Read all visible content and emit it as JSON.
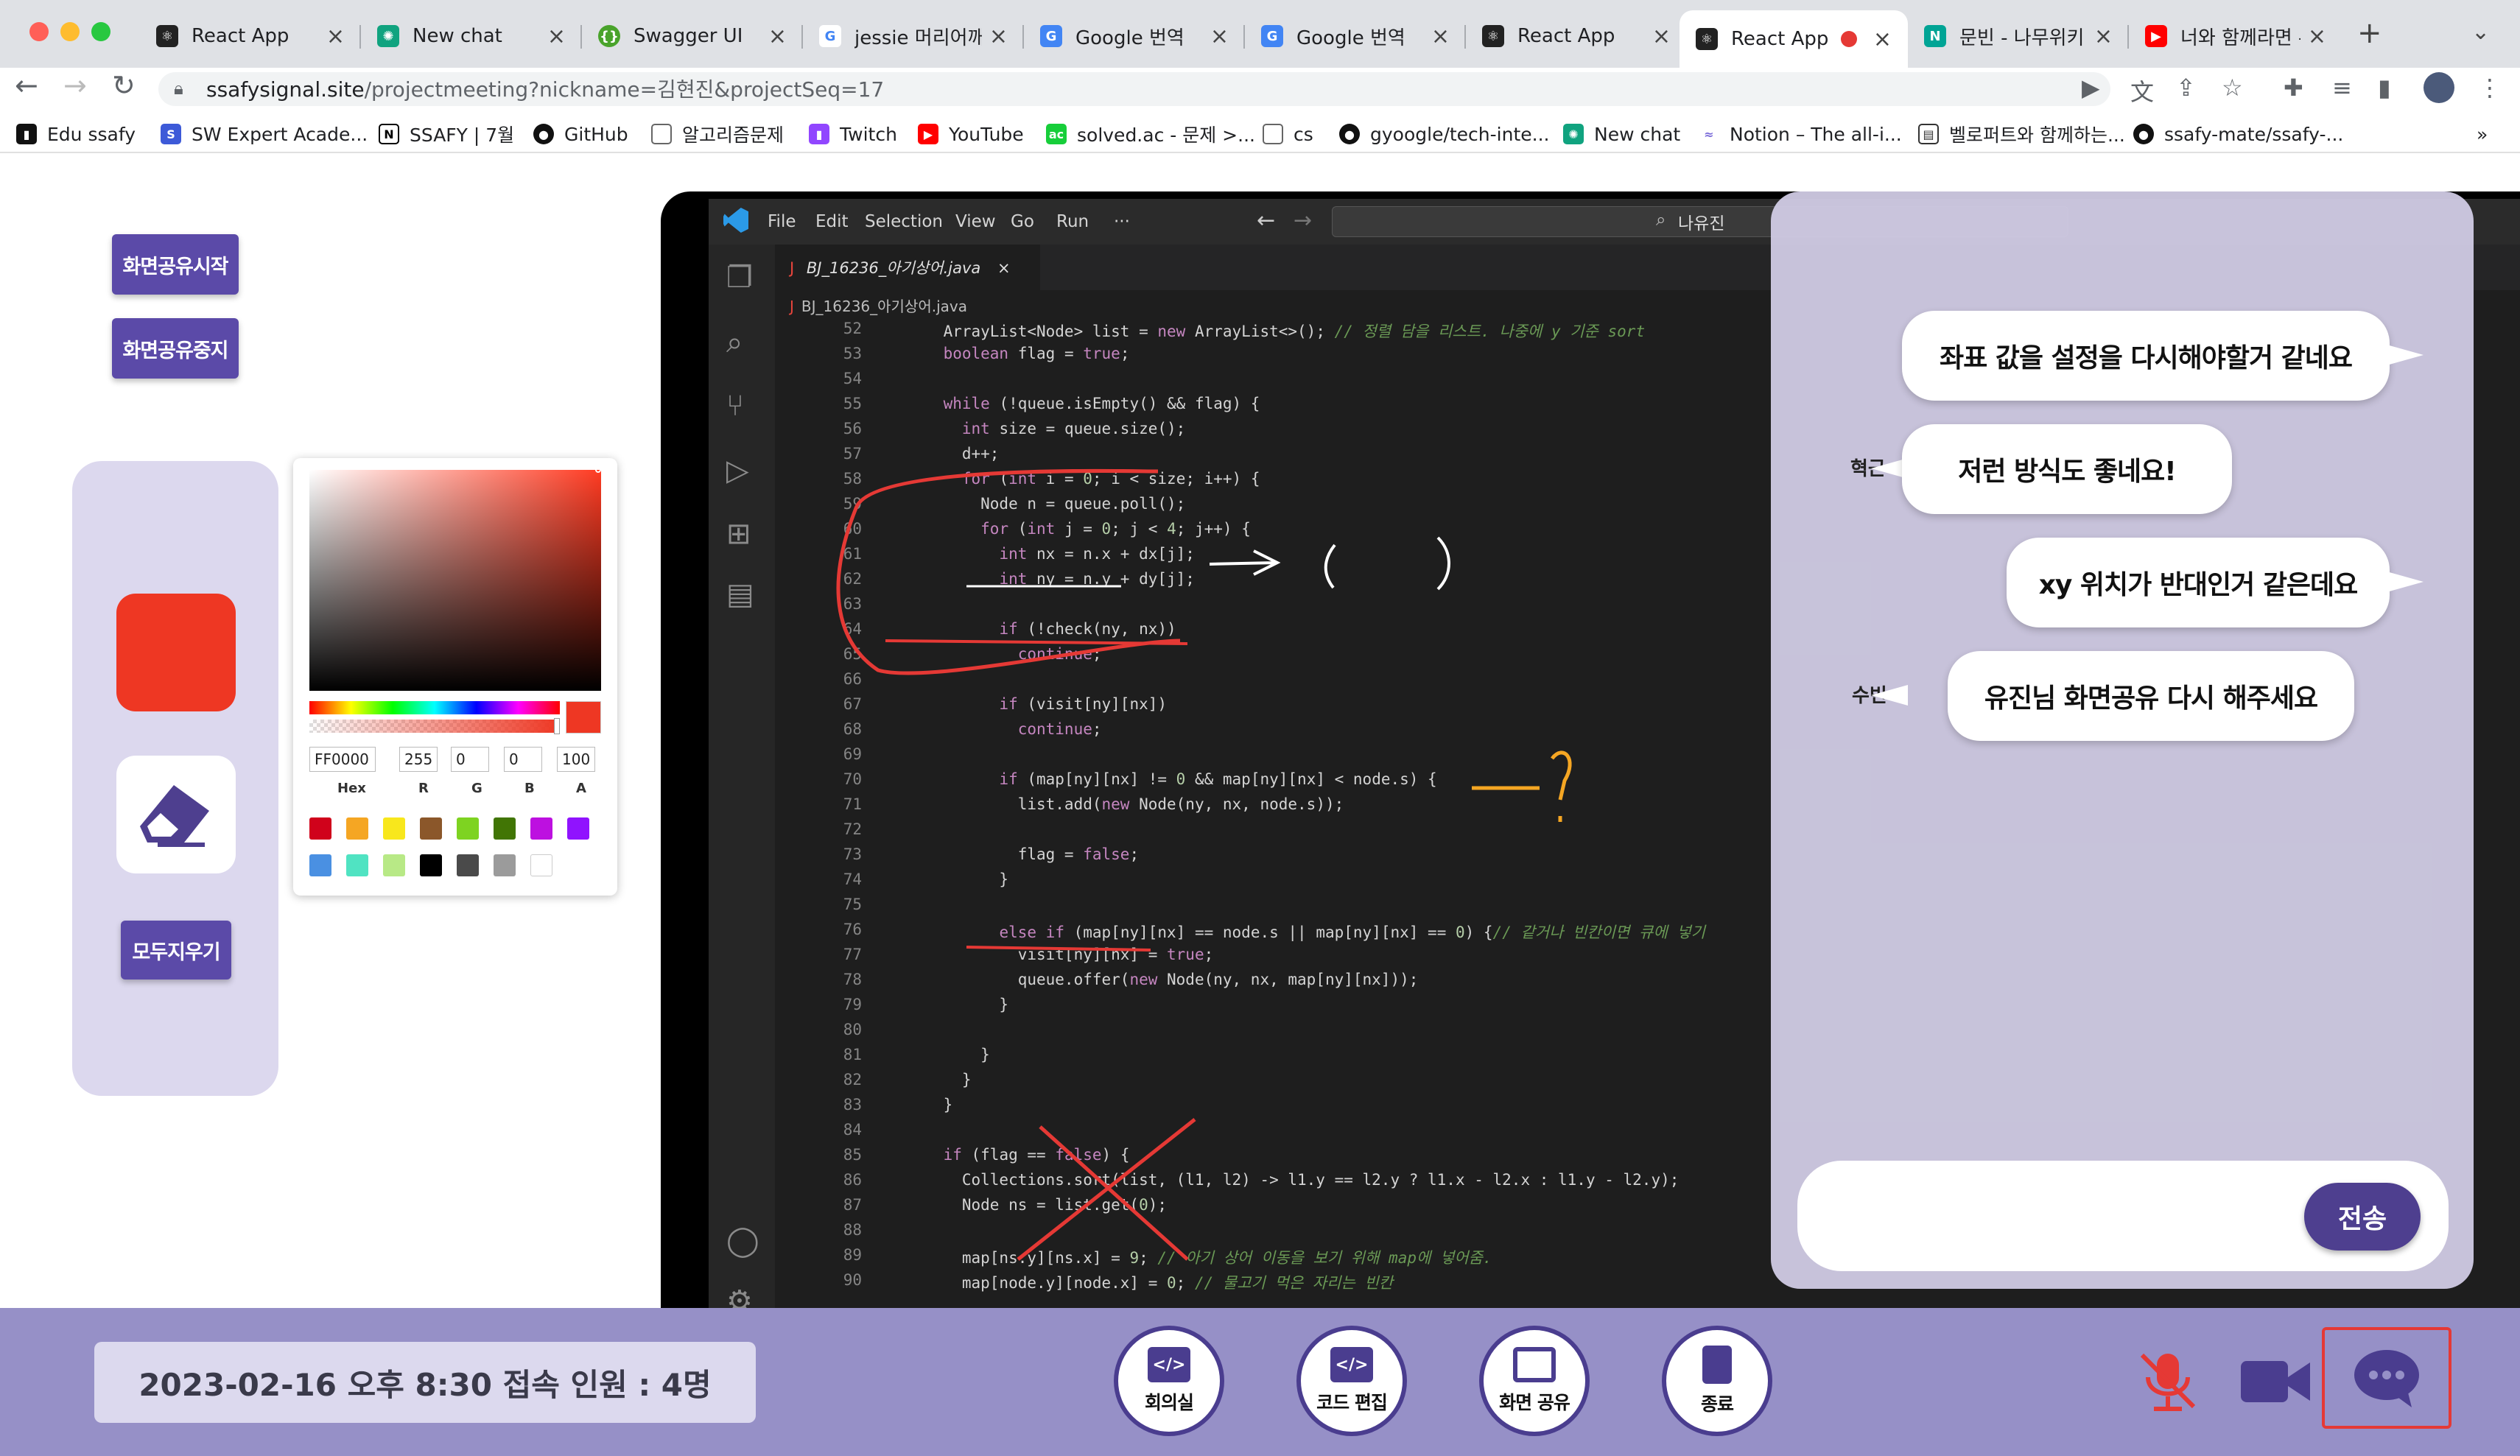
{
  "browser": {
    "tabs": [
      {
        "title": "React App",
        "icon": "react-icon",
        "color": "#222"
      },
      {
        "title": "New chat",
        "icon": "openai-icon",
        "color": "#10a37f"
      },
      {
        "title": "Swagger UI",
        "icon": "swagger-icon",
        "color": "#49a32b"
      },
      {
        "title": "jessie 머리어깨",
        "icon": "google-icon",
        "color": "#4285f4"
      },
      {
        "title": "Google 번역",
        "icon": "translate-icon",
        "color": "#4285f4"
      },
      {
        "title": "Google 번역",
        "icon": "translate-icon",
        "color": "#4285f4"
      },
      {
        "title": "React App",
        "icon": "react-icon",
        "color": "#222"
      },
      {
        "title": "React App",
        "icon": "react-icon",
        "color": "#222"
      },
      {
        "title": "문빈 - 나무위키",
        "icon": "namuwiki-icon",
        "color": "#00a495"
      },
      {
        "title": "너와 함께라면 -",
        "icon": "youtube-icon",
        "color": "#ff0000"
      }
    ],
    "url_host": "ssafysignal.site",
    "url_path": "/projectmeeting?nickname=김현진&projectSeq=17",
    "bookmarks": [
      "Edu ssafy",
      "SW Expert Acade...",
      "SSAFY | 7월",
      "GitHub",
      "알고리즘문제",
      "Twitch",
      "YouTube",
      "solved.ac - 문제 >...",
      "cs",
      "gyoogle/tech-inte...",
      "New chat",
      "Notion – The all-i...",
      "벨로퍼트와 함께하는...",
      "ssafy-mate/ssafy-..."
    ]
  },
  "sidebar": {
    "share_start": "화면공유시작",
    "share_stop": "화면공유중지",
    "clear_all": "모두지우기"
  },
  "picker": {
    "hex": "FF0000",
    "r": "255",
    "g": "0",
    "b": "0",
    "a": "100",
    "labels": [
      "Hex",
      "R",
      "G",
      "B",
      "A"
    ],
    "swatches": [
      "#d0021b",
      "#f5a623",
      "#f8e71c",
      "#8b572a",
      "#7ed321",
      "#417505",
      "#bd10e0",
      "#9013fe",
      "#4a90e2",
      "#50e3c2",
      "#b8e986",
      "#000000",
      "#4a4a4a",
      "#9b9b9b",
      "#ffffff"
    ]
  },
  "vscode": {
    "menus": [
      "File",
      "Edit",
      "Selection",
      "View",
      "Go",
      "Run",
      "···"
    ],
    "search": "나유진",
    "tab": "BJ_16236_아기상어.java",
    "breadcrumb": "BJ_16236_아기상어.java",
    "lines": [
      {
        "n": "52",
        "t": "    ArrayList<Node> list = new ArrayList<>(); // 정렬 담을 리스트. 나중에 y 기준 sort"
      },
      {
        "n": "53",
        "t": "    boolean flag = true;"
      },
      {
        "n": "54",
        "t": ""
      },
      {
        "n": "55",
        "t": "    while (!queue.isEmpty() && flag) {"
      },
      {
        "n": "56",
        "t": "      int size = queue.size();"
      },
      {
        "n": "57",
        "t": "      d++;"
      },
      {
        "n": "58",
        "t": "      for (int i = 0; i < size; i++) {"
      },
      {
        "n": "59",
        "t": "        Node n = queue.poll();"
      },
      {
        "n": "60",
        "t": "        for (int j = 0; j < 4; j++) {"
      },
      {
        "n": "61",
        "t": "          int nx = n.x + dx[j];"
      },
      {
        "n": "62",
        "t": "          int ny = n.y + dy[j];"
      },
      {
        "n": "63",
        "t": ""
      },
      {
        "n": "64",
        "t": "          if (!check(ny, nx))"
      },
      {
        "n": "65",
        "t": "            continue;"
      },
      {
        "n": "66",
        "t": ""
      },
      {
        "n": "67",
        "t": "          if (visit[ny][nx])"
      },
      {
        "n": "68",
        "t": "            continue;"
      },
      {
        "n": "69",
        "t": ""
      },
      {
        "n": "70",
        "t": "          if (map[ny][nx] != 0 && map[ny][nx] < node.s) {"
      },
      {
        "n": "71",
        "t": "            list.add(new Node(ny, nx, node.s));"
      },
      {
        "n": "72",
        "t": ""
      },
      {
        "n": "73",
        "t": "            flag = false;"
      },
      {
        "n": "74",
        "t": "          }"
      },
      {
        "n": "75",
        "t": ""
      },
      {
        "n": "76",
        "t": "          else if (map[ny][nx] == node.s || map[ny][nx] == 0) {// 같거나 빈칸이면 큐에 넣기"
      },
      {
        "n": "77",
        "t": "            visit[ny][nx] = true;"
      },
      {
        "n": "78",
        "t": "            queue.offer(new Node(ny, nx, map[ny][nx]));"
      },
      {
        "n": "79",
        "t": "          }"
      },
      {
        "n": "80",
        "t": ""
      },
      {
        "n": "81",
        "t": "        }"
      },
      {
        "n": "82",
        "t": "      }"
      },
      {
        "n": "83",
        "t": "    }"
      },
      {
        "n": "84",
        "t": ""
      },
      {
        "n": "85",
        "t": "    if (flag == false) {"
      },
      {
        "n": "86",
        "t": "      Collections.sort(list, (l1, l2) -> l1.y == l2.y ? l1.x - l2.x : l1.y - l2.y);"
      },
      {
        "n": "87",
        "t": "      Node ns = list.get(0);"
      },
      {
        "n": "88",
        "t": ""
      },
      {
        "n": "89",
        "t": "      map[ns.y][ns.x] = 9; // 아기 상어 이동을 보기 위해 map에 넣어줌."
      },
      {
        "n": "90",
        "t": "      map[node.y][node.x] = 0; // 물고기 먹은 자리는 빈칸"
      }
    ]
  },
  "chat": {
    "messages": [
      {
        "nick": "",
        "text": "좌표 값을 설정을 다시해야할거 같네요"
      },
      {
        "nick": "혁근",
        "text": "저런 방식도 좋네요!"
      },
      {
        "nick": "",
        "text": "xy 위치가 반대인거 같은데요"
      },
      {
        "nick": "수빈",
        "text": "유진님 화면공유 다시 해주세요"
      }
    ],
    "send": "전송",
    "input_value": ""
  },
  "footer": {
    "status": "2023-02-16 오후 8:30 접속 인원 : 4명",
    "buttons": [
      "회의실",
      "코드 편집",
      "화면 공유",
      "종료"
    ]
  },
  "colors": {
    "primary": "#5b4aa8",
    "bar": "#9690c7",
    "mic_off": "#e53935",
    "active_outline": "#e53935"
  }
}
